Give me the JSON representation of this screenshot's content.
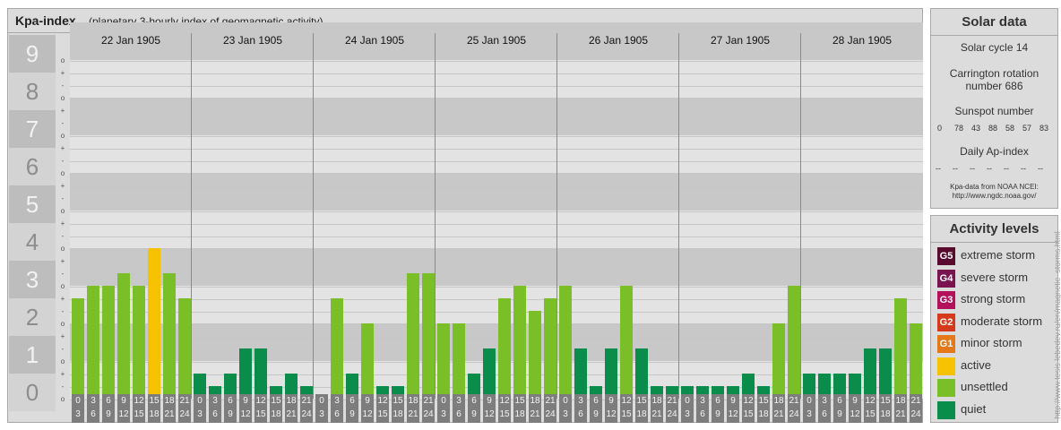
{
  "header": {
    "title": "Kpa-index",
    "subtitle": "(planetary 3-hourly index of geomagnetic activity)"
  },
  "y_levels": [
    "9",
    "8",
    "7",
    "6",
    "5",
    "4",
    "3",
    "2",
    "1",
    "0"
  ],
  "minor_marks": [
    "o",
    "-",
    "+",
    "o",
    "-",
    "+",
    "o",
    "-",
    "+",
    "o",
    "-",
    "+",
    "o",
    "-",
    "+",
    "o",
    "-",
    "+",
    "o",
    "-",
    "+",
    "o",
    "-",
    "+",
    "o",
    "-",
    "+",
    "o"
  ],
  "days": [
    "22 Jan 1905",
    "23 Jan 1905",
    "24 Jan 1905",
    "25 Jan 1905",
    "26 Jan 1905",
    "27 Jan 1905",
    "28 Jan 1905"
  ],
  "slot_labels": [
    [
      "0",
      "3"
    ],
    [
      "3",
      "6"
    ],
    [
      "6",
      "9"
    ],
    [
      "9",
      "12"
    ],
    [
      "12",
      "15"
    ],
    [
      "15",
      "18"
    ],
    [
      "18",
      "21"
    ],
    [
      "21",
      "24"
    ]
  ],
  "colors": {
    "quiet": "#0a8c4a",
    "unsettled": "#7bbf28",
    "active": "#f6c200",
    "band_dark": "#c8c8c8",
    "band_light": "#e3e3e3",
    "time_box": "#7d7d7d"
  },
  "chart_data": {
    "type": "bar",
    "ylim": [
      0,
      9
    ],
    "x": [
      "22 Jan 1905",
      "23 Jan 1905",
      "24 Jan 1905",
      "25 Jan 1905",
      "26 Jan 1905",
      "27 Jan 1905",
      "28 Jan 1905"
    ],
    "series": [
      {
        "values": [
          [
            2.67,
            3,
            3,
            3.33,
            3,
            4,
            3.33,
            2.67
          ],
          [
            0.67,
            0.33,
            0.67,
            1.33,
            1.33,
            0.33,
            0.67,
            0.33
          ],
          [
            0,
            2.67,
            0.67,
            2,
            0.33,
            0.33,
            3.33,
            3.33
          ],
          [
            2,
            2,
            0.67,
            1.33,
            2.67,
            3,
            2.33,
            2.67
          ],
          [
            3,
            1.33,
            0.33,
            1.33,
            3,
            1.33,
            0.33,
            0.33
          ],
          [
            0.33,
            0.33,
            0.33,
            0.33,
            0.67,
            0.33,
            2,
            3
          ],
          [
            0.67,
            0.67,
            0.67,
            0.67,
            1.33,
            1.33,
            2.67,
            2
          ]
        ]
      }
    ]
  },
  "solar": {
    "title": "Solar data",
    "cycle": "Solar cycle 14",
    "carrington_line1": "Carrington rotation",
    "carrington_line2": "number 686",
    "sunspot_label": "Sunspot number",
    "sunspots": [
      "0",
      "78",
      "43",
      "88",
      "58",
      "57",
      "83"
    ],
    "ap_label": "Daily Ap-index",
    "ap_values": [
      "--",
      "--",
      "--",
      "--",
      "--",
      "--",
      "--"
    ],
    "source_line1": "Kpa-data from NOAA NCEI:",
    "source_line2": "http://www.ngdc.noaa.gov/"
  },
  "activity": {
    "title": "Activity levels",
    "levels": [
      {
        "badge": "G5",
        "label": "extreme storm",
        "color": "#5a0a2d"
      },
      {
        "badge": "G4",
        "label": "severe storm",
        "color": "#7a1450"
      },
      {
        "badge": "G3",
        "label": "strong storm",
        "color": "#b3115c"
      },
      {
        "badge": "G2",
        "label": "moderate storm",
        "color": "#d63a1c"
      },
      {
        "badge": "G1",
        "label": "minor storm",
        "color": "#e5791a"
      },
      {
        "badge": "",
        "label": "active",
        "color": "#f6c200"
      },
      {
        "badge": "",
        "label": "unsettled",
        "color": "#7bbf28"
      },
      {
        "badge": "",
        "label": "quiet",
        "color": "#0a8c4a"
      }
    ]
  },
  "credit": "http://www.tesis.lebedev.ru/en/magnetic_storms.html"
}
